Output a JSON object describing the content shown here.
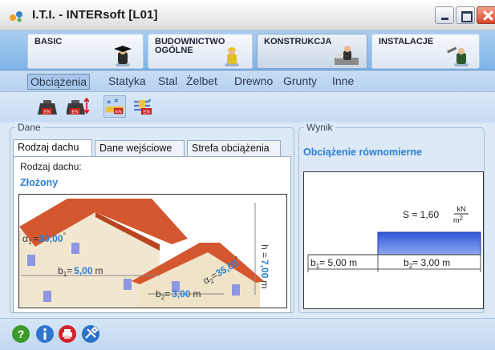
{
  "window": {
    "title": "I.T.I. - INTERsoft [L01]"
  },
  "modules": [
    {
      "label": "BASIC",
      "icon": "graduation-cap-icon"
    },
    {
      "label": "BUDOWNICTWO OGÓLNE",
      "line1": "BUDOWNICTWO",
      "line2": "OGÓLNE",
      "icon": "builder-icon"
    },
    {
      "label": "KONSTRUKCJA",
      "icon": "engineer-icon",
      "active": true
    },
    {
      "label": "INSTALACJE",
      "icon": "plumber-icon"
    }
  ],
  "categories": [
    "Obciążenia",
    "Statyka",
    "Stal",
    "Żelbet",
    "Drewno",
    "Grunty",
    "Inne"
  ],
  "active_category": "Obciążenia",
  "tools": [
    "weight-en-icon",
    "weight-arrow-en-icon",
    "snow-en-icon",
    "wind-en-icon"
  ],
  "dane": {
    "title": "Dane",
    "tabs": [
      "Rodzaj dachu",
      "Dane wejściowe",
      "Strefa obciążenia"
    ],
    "active_tab": "Rodzaj dachu",
    "field_label": "Rodzaj dachu:",
    "field_value": "Złożony",
    "figure": {
      "alpha1_prefix": "α",
      "alpha1_sub": "1",
      "alpha1_eq": "=",
      "alpha1_value": "30,00",
      "alpha1_unit": "°",
      "alpha2_prefix": "α",
      "alpha2_sub": "2",
      "alpha2_eq": "=",
      "alpha2_value": "35,00",
      "alpha2_unit": "°",
      "b1_prefix": "b",
      "b1_sub": "1",
      "b1_eq": "=",
      "b1_value": "5,00",
      "b1_unit": "m",
      "b2_prefix": "b",
      "b2_sub": "2",
      "b2_eq": "=",
      "b2_value": "3,00",
      "b2_unit": "m",
      "h_prefix": "h =",
      "h_value": "7,00",
      "h_unit": "m"
    }
  },
  "wynik": {
    "title": "Wynik",
    "result_title": "Obciążenie równomierne",
    "load_label": "S = 1,60",
    "load_unit_num": "kN",
    "load_unit_den": "m",
    "load_unit_den_exp": "2",
    "b1_prefix": "b",
    "b1_sub": "1",
    "b1_text": "= 5,00 m",
    "b2_prefix": "b",
    "b2_sub": "2",
    "b2_text": "= 3,00 m"
  },
  "bottom_icons": [
    "help-icon",
    "info-icon",
    "print-icon",
    "settings-icon"
  ],
  "colors": {
    "accent": "#2a7fd4",
    "load_bar": "#4a74e0",
    "roof": "#d4572f"
  }
}
